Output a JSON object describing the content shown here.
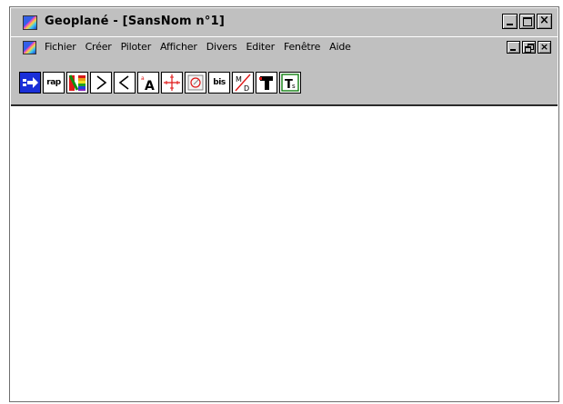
{
  "window": {
    "title": "Geoplané - [SansNom n°1]",
    "app_icon": "geoplan-app-icon",
    "controls": [
      "minimize-icon",
      "maximize-icon",
      "close-icon"
    ],
    "close_glyph": "×"
  },
  "menubar": {
    "items": [
      {
        "label": "Fichier"
      },
      {
        "label": "Créer"
      },
      {
        "label": "Piloter"
      },
      {
        "label": "Afficher"
      },
      {
        "label": "Divers"
      },
      {
        "label": "Editer"
      },
      {
        "label": "Fenêtre"
      },
      {
        "label": "Aide"
      }
    ],
    "mdi_controls": [
      "minimize-icon",
      "restore-icon",
      "close-icon"
    ],
    "close_glyph": "×"
  },
  "toolbar": {
    "tools": [
      {
        "name": "send-arrow-icon"
      },
      {
        "name": "rap-button",
        "label": "rap"
      },
      {
        "name": "color-palette-icon"
      },
      {
        "name": "greater-than-icon",
        "label": ">"
      },
      {
        "name": "less-than-icon",
        "label": "<"
      },
      {
        "name": "text-size-icon",
        "label": "A"
      },
      {
        "name": "axes-icon"
      },
      {
        "name": "circle-icon"
      },
      {
        "name": "bis-button",
        "label": "bis"
      },
      {
        "name": "fraction-md-icon",
        "label_top": "M",
        "label_bottom": "D"
      },
      {
        "name": "hammer-icon"
      },
      {
        "name": "ts-icon",
        "label": "Ts"
      }
    ]
  },
  "colors": {
    "chrome": "#c0c0c0",
    "client": "#ffffff",
    "accent_blue": "#1a2fd8"
  }
}
